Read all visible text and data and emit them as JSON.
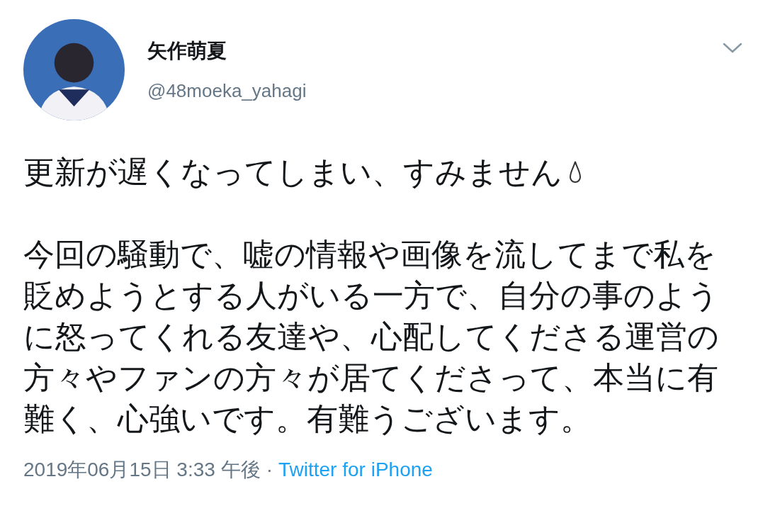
{
  "author": {
    "name": "矢作萌夏",
    "handle": "@48moeka_yahagi"
  },
  "tweet": {
    "first_line": "更新が遅くなってしまい、すみません",
    "paragraph_lines": [
      "今回の騒動で、嘘の情報や画像を流してまで私を",
      "貶めようとする人がいる一方で、自分の事のよう",
      "に怒ってくれる友達や、心配してくださる運営の",
      "方々やファンの方々が居てくださって、本当に有",
      "難く、心強いです。有難うございます。"
    ]
  },
  "meta": {
    "timestamp": "2019年06月15日 3:33 午後",
    "separator": "·",
    "source": "Twitter for iPhone"
  }
}
